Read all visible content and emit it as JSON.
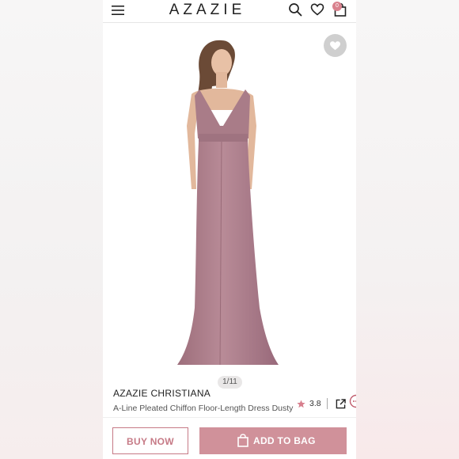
{
  "header": {
    "brand": "AZAZIE",
    "bag_count": "0",
    "icons": [
      "menu-icon",
      "search-icon",
      "heart-icon",
      "bag-icon"
    ]
  },
  "gallery": {
    "counter": "1/11",
    "dress_color": "#b0828f",
    "favorite_icon": "heart-icon"
  },
  "product": {
    "name": "AZAZIE CHRISTIANA",
    "description": "A-Line Pleated Chiffon Floor-Length Dress Dusty",
    "rating": "3.8",
    "rating_icon": "star-icon",
    "share_icon": "share-icon"
  },
  "actions": {
    "buy_now": "BUY NOW",
    "add_to_bag": "ADD TO BAG"
  },
  "colors": {
    "accent": "#d0919a",
    "accent_text": "#c67a86"
  }
}
